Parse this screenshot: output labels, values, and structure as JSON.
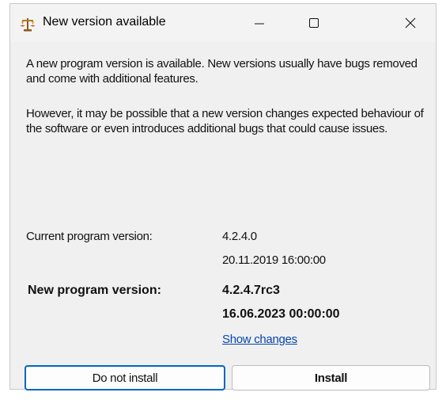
{
  "window": {
    "title": "New version available",
    "icon": "scales-icon"
  },
  "caption_buttons": [
    "minimize-icon",
    "maximize-icon",
    "close-icon"
  ],
  "message": {
    "paragraph1": "A new program version is available. New versions usually have bugs removed and come with additional features.",
    "paragraph2": "However, it may be possible that a new version changes expected behaviour of the software or even introduces additional bugs that could cause issues."
  },
  "current": {
    "label": "Current program version:",
    "version": "4.2.4.0",
    "date": "20.11.2019 16:00:00"
  },
  "new_version": {
    "label": "New program version:",
    "version": "4.2.4.7rc3",
    "date": "16.06.2023 00:00:00"
  },
  "show_changes_link": "Show changes",
  "buttons": {
    "do_not_install": "Do not install",
    "install": "Install"
  },
  "colors": {
    "accent": "#0067c0",
    "link": "#0645ad",
    "window_bg": "#f0f0f0"
  }
}
